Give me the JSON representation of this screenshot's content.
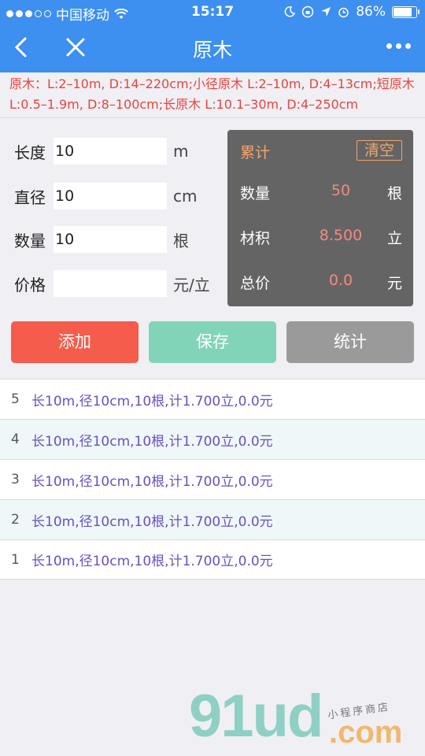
{
  "status": {
    "carrier": "中国移动",
    "time": "15:17",
    "battery": "86%",
    "battery_level": 0.86
  },
  "nav": {
    "title": "原木"
  },
  "info": "原木：L:2–10m, D:14–220cm;小径原木 L:2–10m, D:4–13cm;短原木 L:0.5–1.9m, D:8–100cm;长原木 L:10.1–30m, D:4–250cm",
  "form": {
    "length": {
      "label": "长度",
      "value": "10",
      "unit": "m"
    },
    "diameter": {
      "label": "直径",
      "value": "10",
      "unit": "cm"
    },
    "quantity": {
      "label": "数量",
      "value": "10",
      "unit": "根"
    },
    "price": {
      "label": "价格",
      "value": "",
      "unit": "元/立"
    }
  },
  "summary": {
    "title": "累计",
    "clear_label": "清空",
    "rows": [
      {
        "key": "数量",
        "value": "50",
        "unit": "根"
      },
      {
        "key": "材积",
        "value": "8.500",
        "unit": "立"
      },
      {
        "key": "总价",
        "value": "0.0",
        "unit": "元"
      }
    ]
  },
  "buttons": {
    "add": "添加",
    "save": "保存",
    "stats": "统计"
  },
  "records": [
    {
      "num": "5",
      "text": "长10m,径10cm,10根,计1.700立,0.0元"
    },
    {
      "num": "4",
      "text": "长10m,径10cm,10根,计1.700立,0.0元"
    },
    {
      "num": "3",
      "text": "长10m,径10cm,10根,计1.700立,0.0元"
    },
    {
      "num": "2",
      "text": "长10m,径10cm,10根,计1.700立,0.0元"
    },
    {
      "num": "1",
      "text": "长10m,径10cm,10根,计1.700立,0.0元"
    }
  ],
  "watermark": {
    "logo": "91ud",
    "domain": ".com",
    "tag": "小程序商店"
  }
}
